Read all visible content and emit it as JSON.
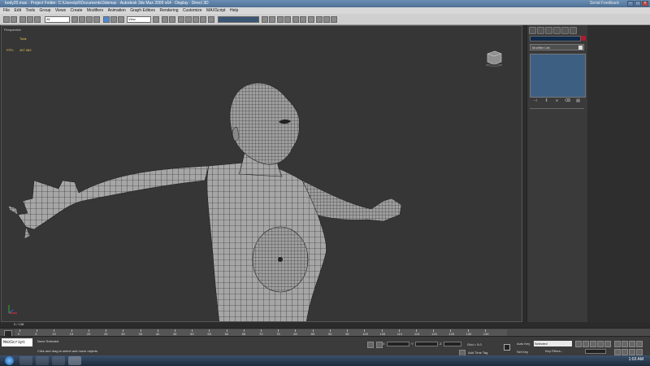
{
  "window": {
    "title": "body20.max    - Project Folder: C:\\Users\\p6\\Documents\\3dsmax    - Autodesk 3ds Max  2009 x64      - Display : Direct 3D",
    "serial_feedback": "Serial Feedback"
  },
  "menu": [
    "File",
    "Edit",
    "Tools",
    "Group",
    "Views",
    "Create",
    "Modifiers",
    "Animation",
    "Graph Editors",
    "Rendering",
    "Customize",
    "MAXScript",
    "Help"
  ],
  "toolbar": {
    "selection_filter": "All",
    "ref_coord": "View"
  },
  "viewport": {
    "label": "Perspective",
    "stats_total_label": "Total",
    "fps_label": "FPS:",
    "fps_value": "457.383"
  },
  "command_panel": {
    "modifier_list": "Modifier List"
  },
  "timeline": {
    "position": "0 / 138",
    "ticks": [
      "0",
      "5",
      "10",
      "15",
      "20",
      "25",
      "30",
      "35",
      "40",
      "45",
      "50",
      "55",
      "60",
      "65",
      "70",
      "75",
      "80",
      "85",
      "90",
      "95",
      "100",
      "105",
      "110",
      "115",
      "120",
      "125",
      "130",
      "135"
    ]
  },
  "status": {
    "maxscript": "MAXScript",
    "selection": "None Selected",
    "prompt": "Click and drag to select and move objects",
    "x_label": "X",
    "y_label": "Y",
    "z_label": "Z",
    "grid": "Grid = 5.0",
    "add_time_tag": "Add Time Tag",
    "auto_key": "Auto Key",
    "set_key": "Set Key",
    "key_mode": "Selected",
    "key_filters": "Key Filters..."
  },
  "taskbar": {
    "clock": "1:03 AM"
  },
  "colors": {
    "viewport_bg": "#363636",
    "wire": "#1a1a1a",
    "skin": "#a9a9a9",
    "stack_bg": "#3d5f82",
    "object_color": "#b01c2f"
  }
}
